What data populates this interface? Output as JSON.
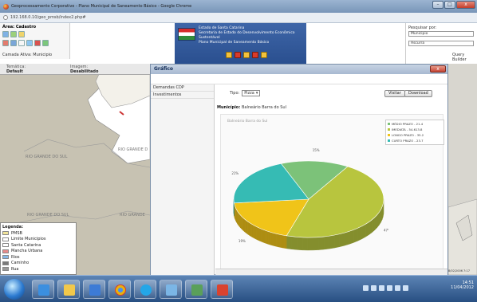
{
  "browser": {
    "title": "Geoprocessamento Corporativo - Plano Municipal de Saneamento Básico - Google Chrome",
    "url": "192.168.0.10/geo_pmsb/index2.php#"
  },
  "app": {
    "area_label": "Área: Cadastro",
    "camada_label": "Camada Ativa: Municipio",
    "tematica_label": "Temática:",
    "tematica_value": "Default",
    "imagem_label": "Imagem:",
    "imagem_value": "Desabilitado",
    "banner": {
      "line1": "Estado de Santa Catarina",
      "line2": "Secretaria de Estado do Desenvolvimento Econômico Sustentável",
      "line3": "Plano Municipal de Saneamento Básico"
    },
    "search": {
      "label": "Pesquisar por:",
      "combo1": "Municipio",
      "combo2": "Ascurra",
      "query_link": "Query Builder"
    }
  },
  "map": {
    "labels": [
      "RIO GRANDE DO SUL",
      "RIO GRANDE D",
      "RIO GRANDE DO SUL",
      "RIO GRANDE"
    ],
    "legend_title": "Legenda:",
    "legend_items": [
      {
        "label": "PMSB",
        "color": "#f1e49a"
      },
      {
        "label": "Limite Municipios",
        "color": "#ffffff"
      },
      {
        "label": "Santa Catarina",
        "color": "#ffffff"
      },
      {
        "label": "Mancha Urbana",
        "color": "#e88a8a"
      },
      {
        "label": "Rios",
        "color": "#86b6e6"
      },
      {
        "label": "Caminho",
        "color": "#7a7a7a"
      },
      {
        "label": "Rua",
        "color": "#9a9a9a"
      }
    ]
  },
  "dialog": {
    "title": "Gráfico",
    "close_label": "x",
    "menu": [
      "Demandas CDP",
      "Investimentos"
    ],
    "tipo_label": "Tipo:",
    "tipo_value": "Pizza",
    "visitar_label": "Visitar",
    "download_label": "Download",
    "municipio_label": "Município:",
    "municipio_value": "Balneário Barra do Sul"
  },
  "chart_data": {
    "type": "pie",
    "title": "Balneário Barra do Sul",
    "labels": [
      "MÉDIO PRAZO - 21.4",
      "IMEDIATA - 54.613.8",
      "LONGO PRAZO - 35.2",
      "CURTO PRAZO - 23.7"
    ],
    "values": [
      15,
      47,
      19,
      21
    ],
    "slice_labels": [
      "15%",
      "47%",
      "19%",
      "21%"
    ],
    "colors": [
      "#7cc279",
      "#b8c53e",
      "#f0c419",
      "#36bbb4"
    ],
    "legend_position": "top-right"
  },
  "taskbar": {
    "time": "14:51",
    "date": "11/04/2012",
    "map_scale": "8/02/2006 7:17"
  }
}
